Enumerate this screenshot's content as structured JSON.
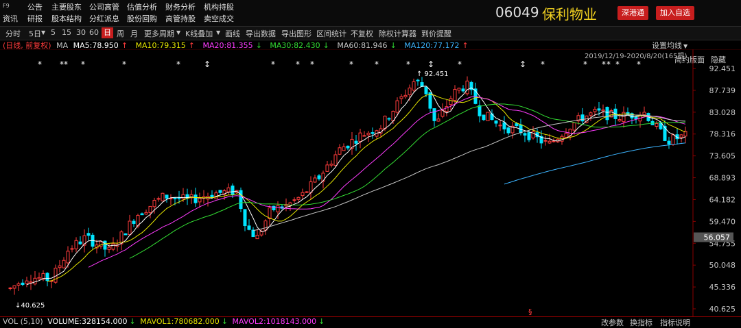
{
  "app": {
    "logo": "F9"
  },
  "menu": {
    "col1": [
      "资讯",
      "研报"
    ],
    "items": [
      [
        "公告",
        "研报"
      ],
      [
        "主要股东",
        "股本结构"
      ],
      [
        "公司高管",
        "分红派息"
      ],
      [
        "估值分析",
        "股份回购"
      ],
      [
        "财务分析",
        "高管持股"
      ],
      [
        "机构持股",
        "卖空成交"
      ]
    ],
    "row1": [
      "公告",
      "主要股东",
      "公司高管",
      "估值分析",
      "财务分析",
      "机构持股"
    ],
    "row2": [
      "研报",
      "股本结构",
      "分红派息",
      "股份回购",
      "高管持股",
      "卖空成交"
    ],
    "left2": "资讯"
  },
  "stock": {
    "code": "06049",
    "name": "保利物业"
  },
  "buttons": {
    "hk_connect": "深港通",
    "add_watch": "加入自选",
    "simple": "简约版面",
    "hide": "隐藏"
  },
  "toolbar": {
    "items": [
      "分时",
      "5日",
      "5",
      "15",
      "30",
      "60",
      "日",
      "周",
      "月",
      "更多周期",
      "K线叠加",
      "画线",
      "导出数据",
      "导出图形",
      "区间统计",
      "不复权",
      "除权计算器",
      "到价提醒"
    ],
    "active": "日"
  },
  "ma": {
    "mode": "(日线, 前复权)",
    "prefix": "MA",
    "ma5": "MA5:78.950",
    "ma10": "MA10:79.315",
    "ma20": "MA20:81.355",
    "ma30": "MA30:82.430",
    "ma60": "MA60:81.946",
    "ma120": "MA120:77.172",
    "arrow5": "↑",
    "arrow10": "↑",
    "arrow20": "↓",
    "arrow30": "↓",
    "arrow60": "↓",
    "arrow120": "↑"
  },
  "settings": {
    "label": "设置均线",
    "icon": "▼"
  },
  "range": "2019/12/19-2020/8/20(165根)",
  "price_ticks": [
    "92.451",
    "87.739",
    "83.028",
    "78.316",
    "73.605",
    "68.893",
    "64.182",
    "59.470",
    "54.755",
    "50.048",
    "45.336",
    "40.625"
  ],
  "current_price": "56.057",
  "annotations": {
    "high": "92.451",
    "low": "40.625"
  },
  "bottom": {
    "vol": "VOL (5,10)",
    "volume": "VOLUME:328154.000",
    "mavol1": "MAVOL1:780682.000",
    "mavol2": "MAVOL2:1018143.000",
    "arrow1": "↓",
    "arrow2": "↓",
    "arrow3": "↓",
    "btn1": "改参数",
    "btn2": "换指标",
    "btn3": "指标说明"
  },
  "colors": {
    "up": "#ff3b3b",
    "down": "#00e5ff",
    "ma5": "#ffffff",
    "ma10": "#e6e600",
    "ma20": "#ff3cff",
    "ma30": "#33dd33",
    "ma60": "#c8c8c8",
    "ma120": "#3cb4ff"
  }
}
